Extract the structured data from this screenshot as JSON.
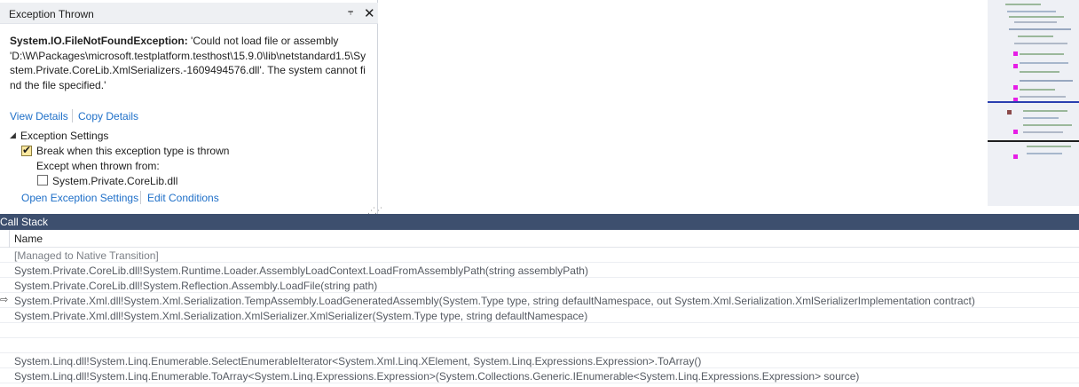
{
  "popup": {
    "title": "Exception Thrown",
    "pin_icon": "pin-icon",
    "close_icon": "close-icon",
    "exception_type": "System.IO.FileNotFoundException:",
    "exception_message": "'Could not load file or assembly 'D:\\W\\Packages\\microsoft.testplatform.testhost\\15.9.0\\lib\\netstandard1.5\\System.Private.CoreLib.XmlSerializers.-1609494576.dll'. The system cannot find the file specified.'",
    "view_details": "View Details",
    "copy_details": "Copy Details",
    "exception_settings": {
      "label": "Exception Settings",
      "expanded": true,
      "break_when_thrown": {
        "label": "Break when this exception type is thrown",
        "checked": true
      },
      "except_when_from": "Except when thrown from:",
      "corelib": {
        "label": "System.Private.CoreLib.dll",
        "checked": false
      }
    },
    "open_exception_settings": "Open Exception Settings",
    "edit_conditions": "Edit Conditions"
  },
  "callstack": {
    "title": "Call Stack",
    "column_name": "Name",
    "rows": [
      {
        "text": "[Managed to Native Transition]",
        "muted": true
      },
      {
        "text": "System.Private.CoreLib.dll!System.Runtime.Loader.AssemblyLoadContext.LoadFromAssemblyPath(string assemblyPath)"
      },
      {
        "text": "System.Private.CoreLib.dll!System.Reflection.Assembly.LoadFile(string path)"
      },
      {
        "text": "System.Private.Xml.dll!System.Xml.Serialization.TempAssembly.LoadGeneratedAssembly(System.Type type, string defaultNamespace, out System.Xml.Serialization.XmlSerializerImplementation contract)",
        "current": true
      },
      {
        "text": "System.Private.Xml.dll!System.Xml.Serialization.XmlSerializer.XmlSerializer(System.Type type, string defaultNamespace)"
      },
      {
        "text": ""
      },
      {
        "text": ""
      },
      {
        "text": "System.Linq.dll!System.Linq.Enumerable.SelectEnumerableIterator<System.Xml.Linq.XElement, System.Linq.Expressions.Expression>.ToArray()"
      },
      {
        "text": "System.Linq.dll!System.Linq.Enumerable.ToArray<System.Linq.Expressions.Expression>(System.Collections.Generic.IEnumerable<System.Linq.Expressions.Expression> source)"
      }
    ]
  },
  "colors": {
    "link": "#1e6fc8",
    "titlebar": "#3d4f6e",
    "minimap_marker": "#e61ee6"
  }
}
